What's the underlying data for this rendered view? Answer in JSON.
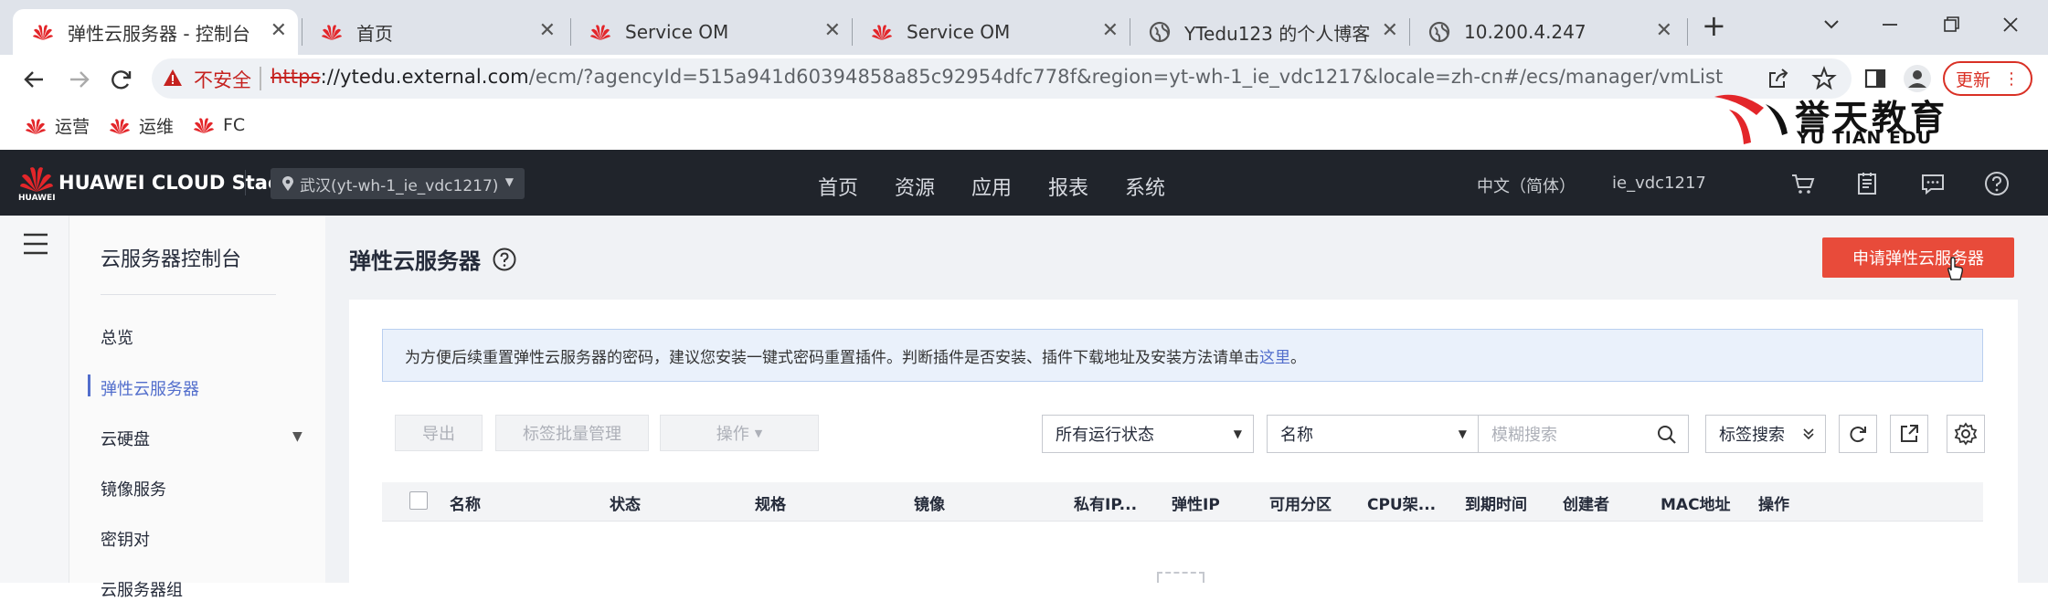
{
  "browser": {
    "tabs": [
      {
        "title": "弹性云服务器 - 控制台",
        "icon": "huawei-icon",
        "active": true
      },
      {
        "title": "首页",
        "icon": "huawei-icon",
        "active": false
      },
      {
        "title": "Service OM",
        "icon": "huawei-icon",
        "active": false
      },
      {
        "title": "Service OM",
        "icon": "huawei-icon",
        "active": false
      },
      {
        "title": "YTedu123 的个人博客",
        "icon": "globe-icon",
        "active": false
      },
      {
        "title": "10.200.4.247",
        "icon": "globe-icon",
        "active": false
      }
    ],
    "tab_close": "✕",
    "new_tab": "+",
    "address": {
      "security_label": "不安全",
      "scheme": "https",
      "host": "://ytedu.external.com",
      "path": "/ecm/?agencyId=515a941d60394858a85c92954dfc778f&region=yt-wh-1_ie_vdc1217&locale=zh-cn#/ecs/manager/vmList"
    },
    "update_button": "更新",
    "bookmarks": [
      {
        "label": "运营",
        "icon": "huawei-icon"
      },
      {
        "label": "运维",
        "icon": "huawei-icon"
      },
      {
        "label": "FC",
        "icon": "huawei-icon"
      }
    ]
  },
  "watermark": {
    "cn": "誉天教育",
    "en": "YU TIAN EDU"
  },
  "header": {
    "brand": "HUAWEI CLOUD Stack",
    "brand_sub": "HUAWEI",
    "region": "武汉(yt-wh-1_ie_vdc1217)",
    "nav": [
      "首页",
      "资源",
      "应用",
      "报表",
      "系统"
    ],
    "language": "中文（简体）",
    "user": "ie_vdc1217",
    "icons": [
      "cart-icon",
      "orders-icon",
      "message-icon",
      "help-icon"
    ]
  },
  "sidebar": {
    "title": "云服务器控制台",
    "items": [
      {
        "label": "总览",
        "active": false
      },
      {
        "label": "弹性云服务器",
        "active": true
      },
      {
        "label": "云硬盘",
        "active": false,
        "expandable": true
      },
      {
        "label": "镜像服务",
        "active": false
      },
      {
        "label": "密钥对",
        "active": false
      },
      {
        "label": "云服务器组",
        "active": false
      }
    ]
  },
  "main": {
    "title": "弹性云服务器",
    "apply_button": "申请弹性云服务器",
    "notice": {
      "text": "为方便后续重置弹性云服务器的密码，建议您安装一键式密码重置插件。判断插件是否安装、插件下载地址及安装方法请单击",
      "link": "这里",
      "end": "。"
    },
    "toolbar": {
      "export": "导出",
      "tag_batch": "标签批量管理",
      "actions": "操作",
      "status_filter": "所有运行状态",
      "search_field": "名称",
      "search_placeholder": "模糊搜索",
      "tag_search": "标签搜索"
    },
    "table": {
      "columns": [
        "名称",
        "状态",
        "规格",
        "镜像",
        "私有IP...",
        "弹性IP",
        "可用分区",
        "CPU架...",
        "到期时间",
        "创建者",
        "MAC地址",
        "操作"
      ]
    }
  },
  "colors": {
    "accent": "#526ecc",
    "primary_button": "#e84b3a",
    "header_bg": "#20242b",
    "insecure": "#c5221f"
  }
}
